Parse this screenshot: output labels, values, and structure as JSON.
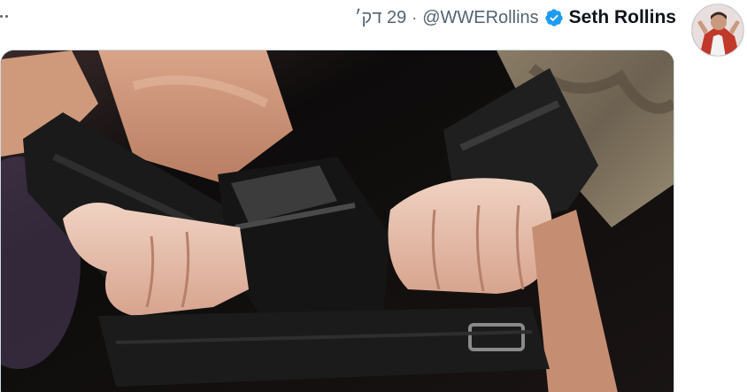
{
  "tweet": {
    "display_name": "Seth Rollins",
    "handle": "@WWERollins",
    "separator": "·",
    "timestamp": "29 דק׳",
    "verified_badge_color": "#1d9bf0",
    "verified_icon": "verified-badge-icon",
    "more_icon": "more-dots-icon",
    "media_image": "photo of two wrestlers' fists bumping with black wrist tape"
  },
  "colors": {
    "name_text": "#0f1419",
    "secondary_text": "#536471",
    "media_border": "#cfd9de"
  }
}
